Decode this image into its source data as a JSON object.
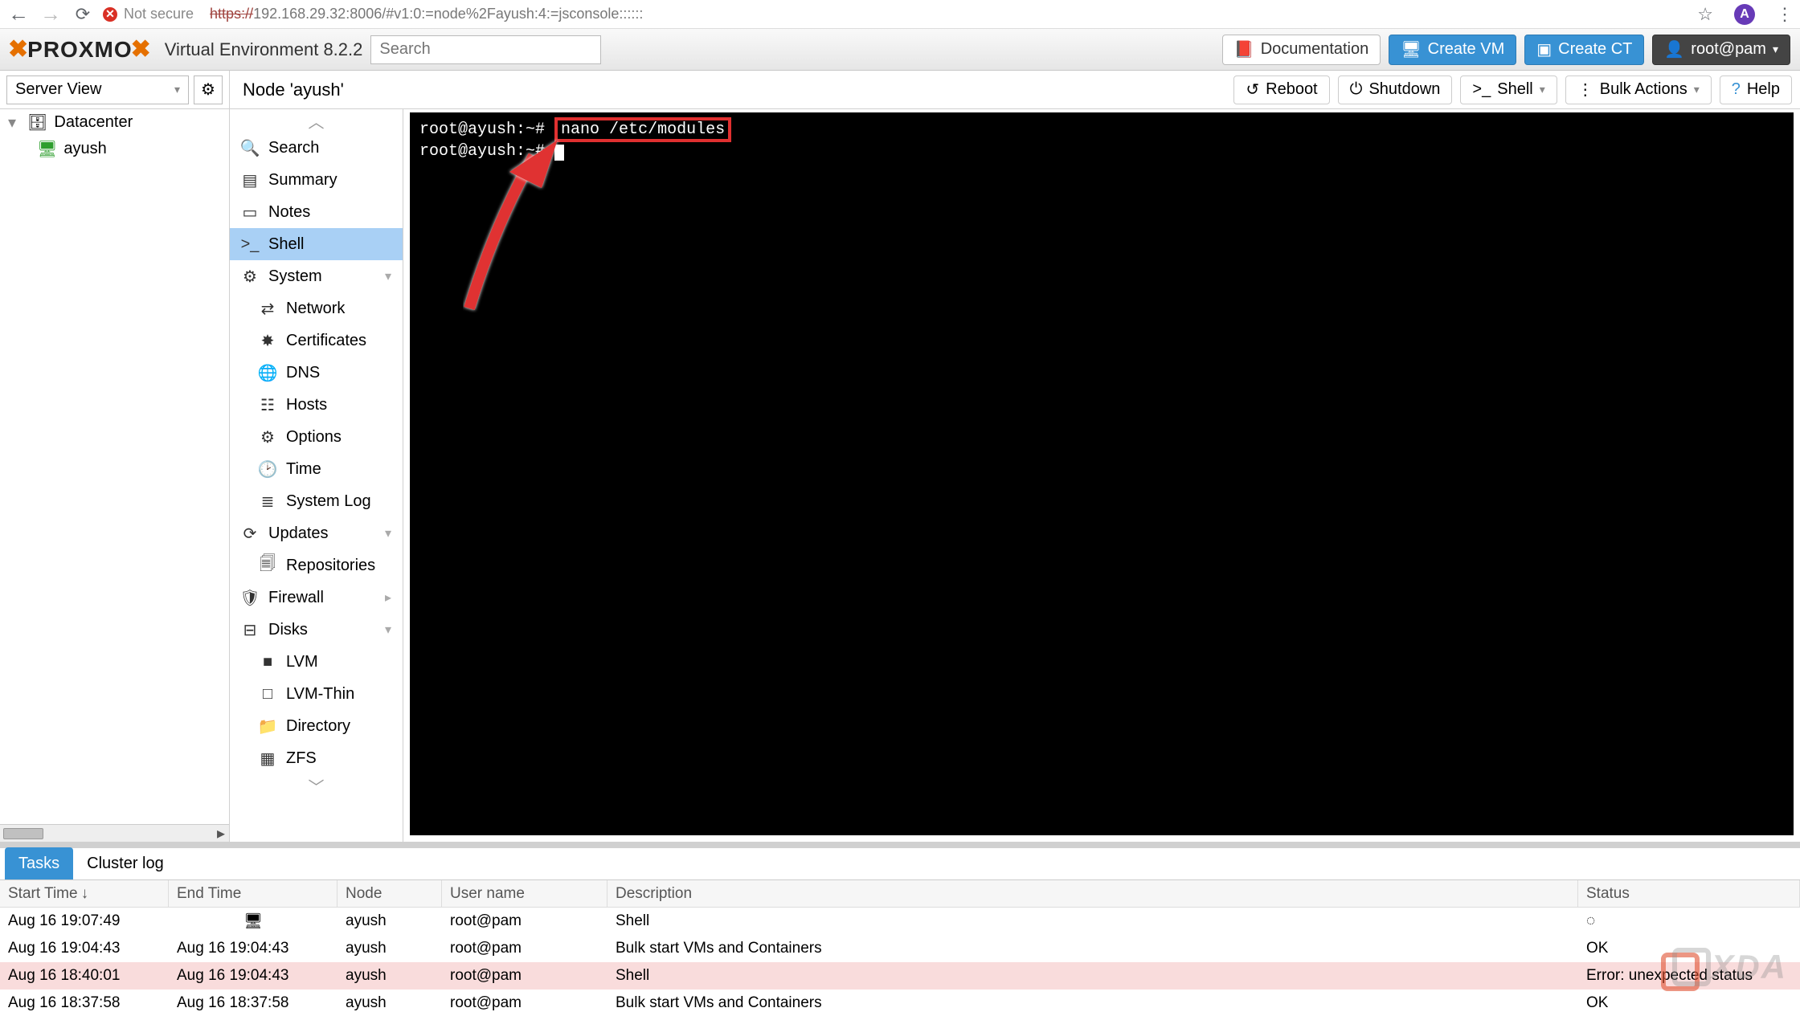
{
  "browser": {
    "insecure_label": "Not secure",
    "url_scheme": "https://",
    "url_rest": "192.168.29.32:8006/#v1:0:=node%2Fayush:4:=jsconsole::::::",
    "avatar_letter": "A"
  },
  "header": {
    "logo_text": "PROXMO",
    "ve_text": "Virtual Environment 8.2.2",
    "search_placeholder": "Search",
    "btn_docs": "Documentation",
    "btn_create_vm": "Create VM",
    "btn_create_ct": "Create CT",
    "btn_user": "root@pam"
  },
  "tree": {
    "view_label": "Server View",
    "datacenter": "Datacenter",
    "node": "ayush"
  },
  "context": {
    "title": "Node 'ayush'",
    "reboot": "Reboot",
    "shutdown": "Shutdown",
    "shell": "Shell",
    "bulk": "Bulk Actions",
    "help": "Help"
  },
  "nav": {
    "search": "Search",
    "summary": "Summary",
    "notes": "Notes",
    "shell": "Shell",
    "system": "System",
    "network": "Network",
    "certs": "Certificates",
    "dns": "DNS",
    "hosts": "Hosts",
    "options": "Options",
    "time": "Time",
    "syslog": "System Log",
    "updates": "Updates",
    "repos": "Repositories",
    "firewall": "Firewall",
    "disks": "Disks",
    "lvm": "LVM",
    "lvmthin": "LVM-Thin",
    "directory": "Directory",
    "zfs": "ZFS"
  },
  "console": {
    "prompt1_pre": "root@ayush:~#",
    "cmd_highlight": "nano /etc/modules",
    "prompt2": "root@ayush:~#"
  },
  "log": {
    "tab_tasks": "Tasks",
    "tab_cluster": "Cluster log",
    "col_start": "Start Time",
    "col_end": "End Time",
    "col_node": "Node",
    "col_user": "User name",
    "col_desc": "Description",
    "col_status": "Status",
    "rows": [
      {
        "start": "Aug 16 19:07:49",
        "end": "",
        "node": "ayush",
        "user": "root@pam",
        "desc": "Shell",
        "status": "",
        "running": true
      },
      {
        "start": "Aug 16 19:04:43",
        "end": "Aug 16 19:04:43",
        "node": "ayush",
        "user": "root@pam",
        "desc": "Bulk start VMs and Containers",
        "status": "OK"
      },
      {
        "start": "Aug 16 18:40:01",
        "end": "Aug 16 19:04:43",
        "node": "ayush",
        "user": "root@pam",
        "desc": "Shell",
        "status": "Error: unexpected status",
        "err": true
      },
      {
        "start": "Aug 16 18:37:58",
        "end": "Aug 16 18:37:58",
        "node": "ayush",
        "user": "root@pam",
        "desc": "Bulk start VMs and Containers",
        "status": "OK"
      }
    ]
  },
  "watermark": "XDA"
}
